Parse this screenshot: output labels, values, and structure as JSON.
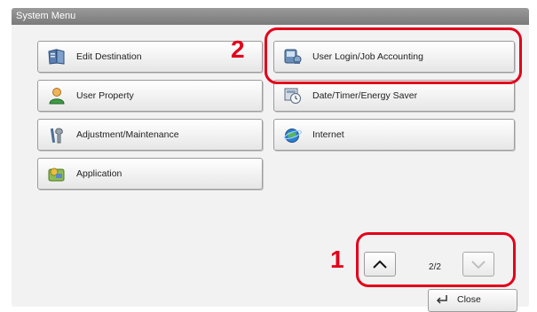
{
  "window": {
    "title": "System Menu"
  },
  "menu_items": [
    {
      "label": "Edit Destination",
      "icon": "address-book-icon"
    },
    {
      "label": "User Login/Job Accounting",
      "icon": "user-login-icon"
    },
    {
      "label": "User Property",
      "icon": "user-person-icon"
    },
    {
      "label": "Date/Timer/Energy Saver",
      "icon": "clock-icon"
    },
    {
      "label": "Adjustment/Maintenance",
      "icon": "tools-icon"
    },
    {
      "label": "Internet",
      "icon": "globe-icon"
    },
    {
      "label": "Application",
      "icon": "application-icon"
    }
  ],
  "pagination": {
    "indicator": "2/2",
    "up_icon": "chevron-up-icon",
    "down_icon": "chevron-down-icon"
  },
  "close": {
    "label": "Close",
    "icon": "return-arrow-icon"
  },
  "callouts": [
    {
      "number": "1",
      "target": "pagination"
    },
    {
      "number": "2",
      "target": "User Login/Job Accounting"
    }
  ],
  "colors": {
    "callout": "#e3001b",
    "titlebar": "#8a8a8a"
  }
}
